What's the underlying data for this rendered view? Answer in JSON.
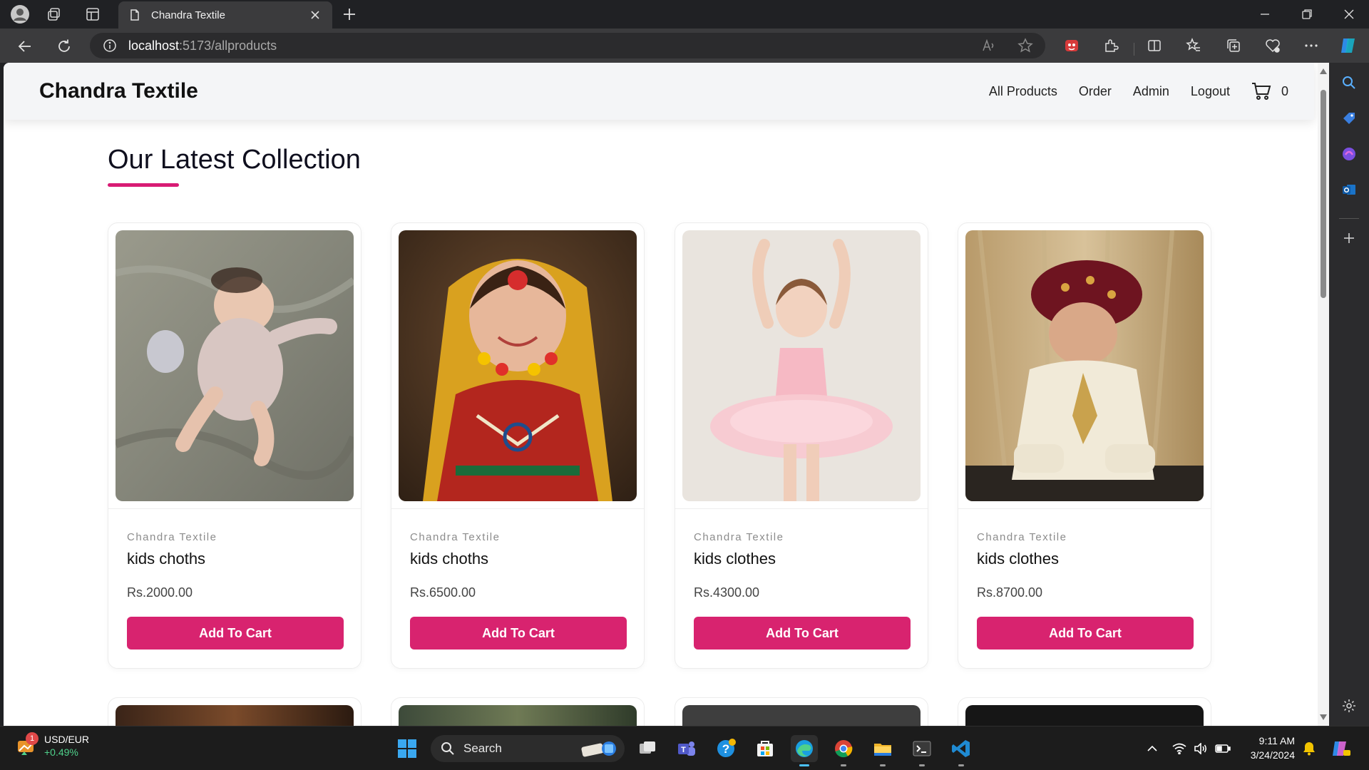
{
  "browser": {
    "tab_title": "Chandra Textile",
    "url_host": "localhost",
    "url_path": ":5173/allproducts"
  },
  "site": {
    "brand": "Chandra Textile",
    "nav": {
      "all_products": "All Products",
      "order": "Order",
      "admin": "Admin",
      "logout": "Logout",
      "cart_count": "0"
    },
    "section_title": "Our Latest Collection"
  },
  "products": [
    {
      "brand": "Chandra Textile",
      "name": "kids choths",
      "price": "Rs.2000.00",
      "button": "Add To Cart",
      "image": "baby-on-blanket-photo"
    },
    {
      "brand": "Chandra Textile",
      "name": "kids choths",
      "price": "Rs.6500.00",
      "button": "Add To Cart",
      "image": "girl-traditional-dress-photo"
    },
    {
      "brand": "Chandra Textile",
      "name": "kids clothes",
      "price": "Rs.4300.00",
      "button": "Add To Cart",
      "image": "ballerina-girl-photo"
    },
    {
      "brand": "Chandra Textile",
      "name": "kids clothes",
      "price": "Rs.8700.00",
      "button": "Add To Cart",
      "image": "boy-sherwani-turban-photo"
    }
  ],
  "taskbar": {
    "widget_title": "USD/EUR",
    "widget_change": "+0.49%",
    "widget_badge": "1",
    "search_label": "Search",
    "time": "9:11 AM",
    "date": "3/24/2024"
  },
  "colors": {
    "accent": "#d8236f",
    "underline": "#d81b74"
  }
}
